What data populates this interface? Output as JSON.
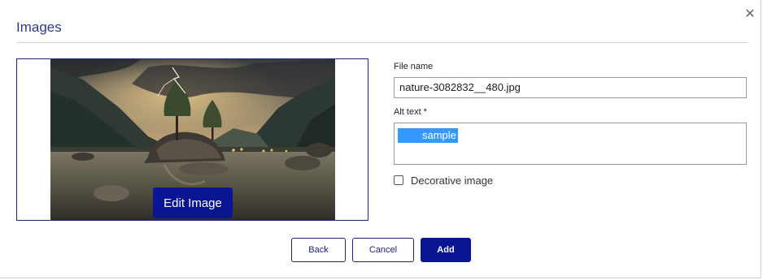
{
  "dialog": {
    "title": "Images",
    "close_icon": "close-icon"
  },
  "preview": {
    "edit_button_label": "Edit Image",
    "image_alt": "Mountain lake with a small rocky island of trees under a stormy sky with lightning"
  },
  "form": {
    "file_name_label": "File name",
    "file_name_value": "nature-3082832__480.jpg",
    "alt_text_label": "Alt text *",
    "alt_text_value": "sample",
    "decorative_label": "Decorative image",
    "decorative_checked": false
  },
  "actions": {
    "back_label": "Back",
    "cancel_label": "Cancel",
    "add_label": "Add"
  },
  "colors": {
    "accent": "#0a1593",
    "title": "#2b3a8f",
    "selection": "#3399ff"
  }
}
